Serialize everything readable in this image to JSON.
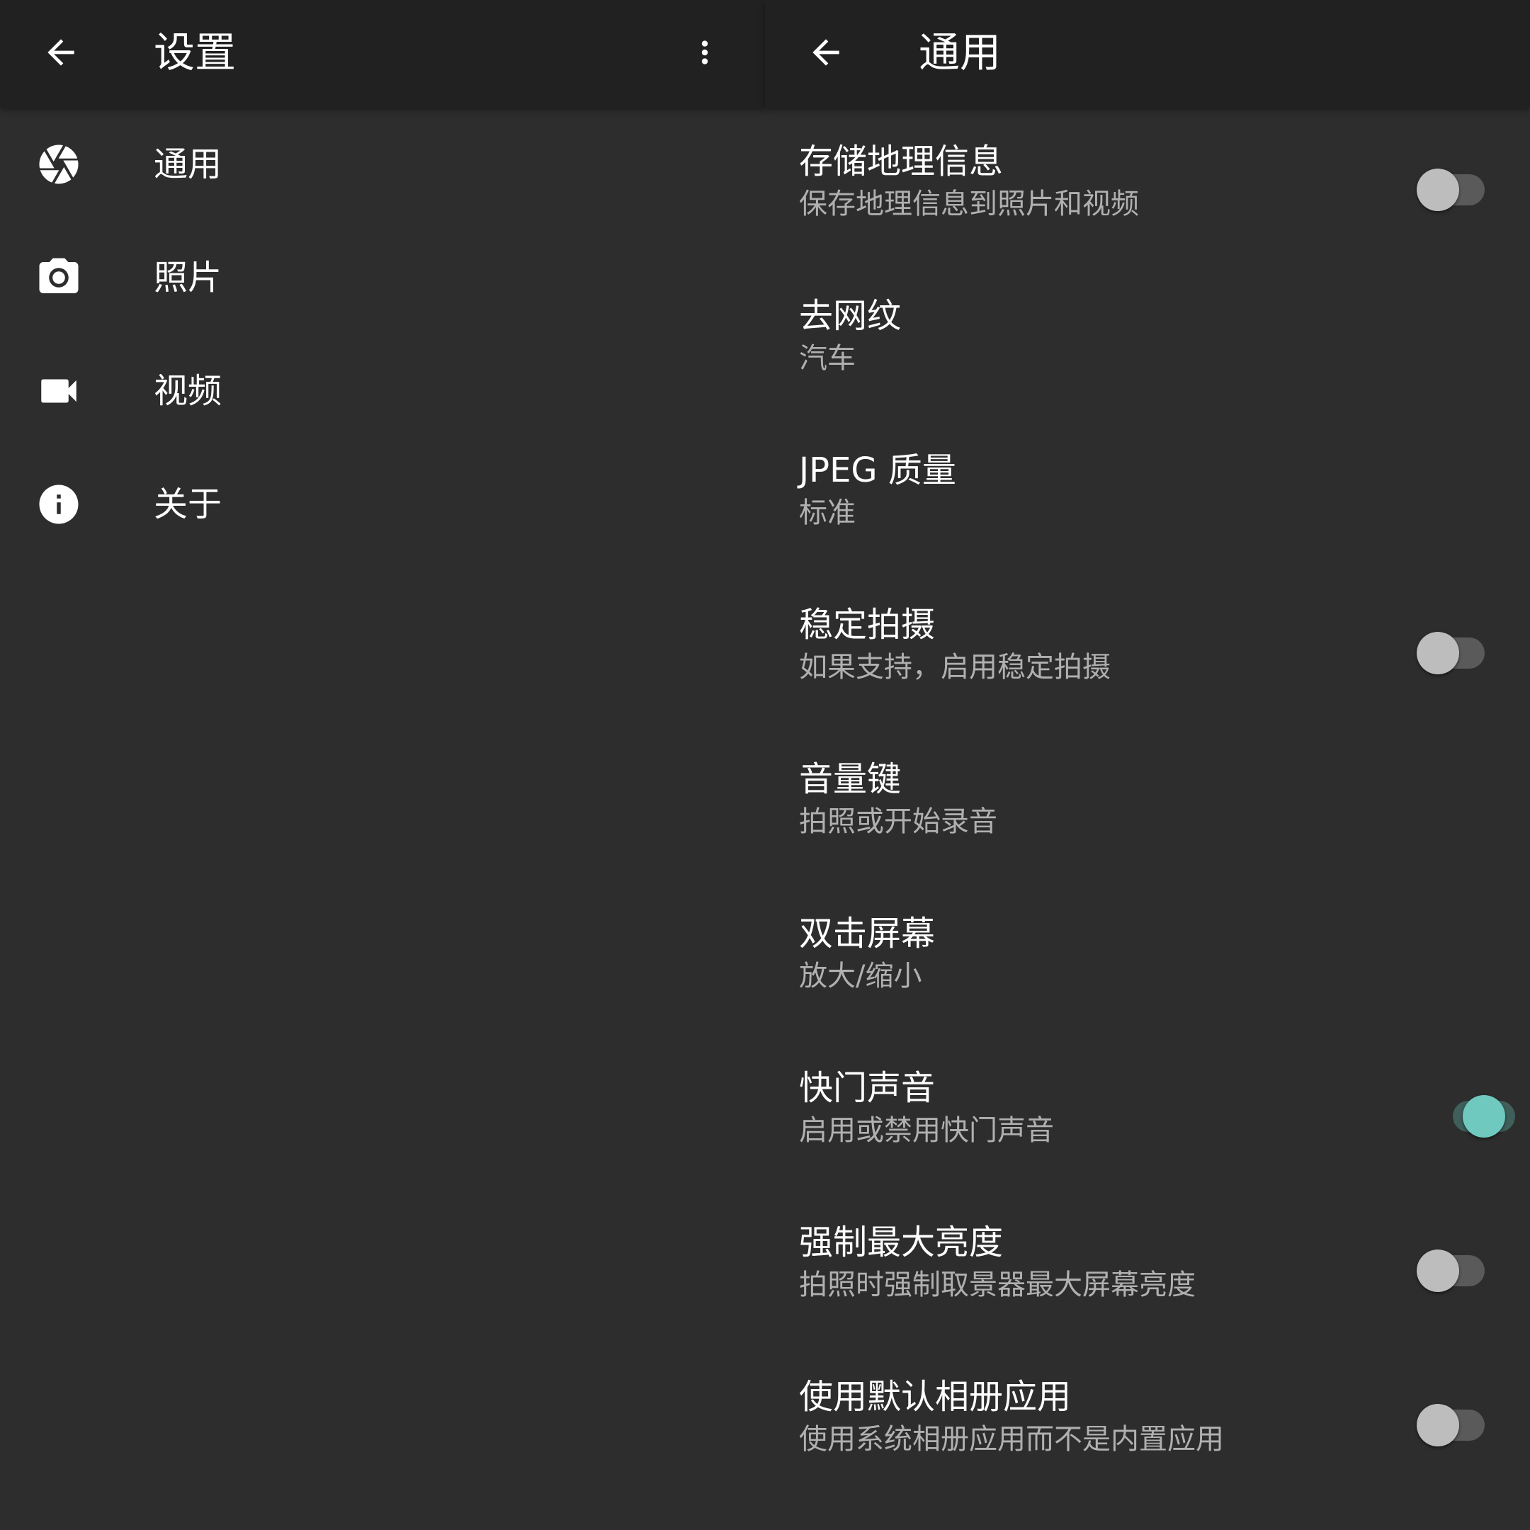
{
  "left": {
    "title": "设置",
    "icons": {
      "back": "arrow-back-icon",
      "overflow": "more-vert-icon"
    },
    "menu": [
      {
        "label": "通用",
        "icon": "aperture-icon"
      },
      {
        "label": "照片",
        "icon": "camera-icon"
      },
      {
        "label": "视频",
        "icon": "videocam-icon"
      },
      {
        "label": "关于",
        "icon": "info-icon"
      }
    ]
  },
  "right": {
    "title": "通用",
    "icons": {
      "back": "arrow-back-icon"
    },
    "prefs": [
      {
        "title": "存储地理信息",
        "summary": "保存地理信息到照片和视频",
        "switch": "off"
      },
      {
        "title": "去网纹",
        "summary": "汽车"
      },
      {
        "title": "JPEG 质量",
        "summary": "标准"
      },
      {
        "title": "稳定拍摄",
        "summary": "如果支持，启用稳定拍摄",
        "switch": "off"
      },
      {
        "title": "音量键",
        "summary": "拍照或开始录音"
      },
      {
        "title": "双击屏幕",
        "summary": "放大/缩小"
      },
      {
        "title": "快门声音",
        "summary": "启用或禁用快门声音",
        "switch": "on"
      },
      {
        "title": "强制最大亮度",
        "summary": "拍照时强制取景器最大屏幕亮度",
        "switch": "off"
      },
      {
        "title": "使用默认相册应用",
        "summary": "使用系统相册应用而不是内置应用",
        "switch": "off"
      }
    ]
  },
  "colors": {
    "background": "#2d2d2d",
    "appbar": "#212121",
    "text_primary": "#ffffff",
    "text_secondary": "#b0b0b0",
    "accent": "#6fc9bf"
  }
}
